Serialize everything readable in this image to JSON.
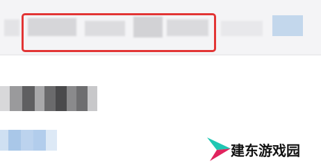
{
  "search_bar": {
    "highlight_color": "#e23434",
    "button_color": "#c3d7ec"
  },
  "watermark": {
    "text": "建东游戏园",
    "logo_colors": [
      "#1fc7b3",
      "#e0245e"
    ]
  }
}
